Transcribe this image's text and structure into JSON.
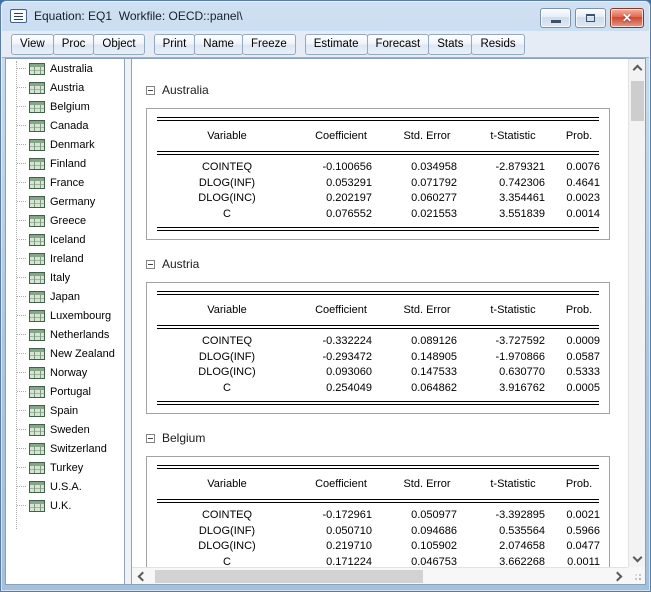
{
  "window": {
    "title": "Equation: EQ1  Workfile: OECD::panel\\"
  },
  "toolbar": {
    "groups": [
      [
        "View",
        "Proc",
        "Object"
      ],
      [
        "Print",
        "Name",
        "Freeze"
      ],
      [
        "Estimate",
        "Forecast",
        "Stats",
        "Resids"
      ]
    ]
  },
  "sidebar": {
    "items": [
      "Australia",
      "Austria",
      "Belgium",
      "Canada",
      "Denmark",
      "Finland",
      "France",
      "Germany",
      "Greece",
      "Iceland",
      "Ireland",
      "Italy",
      "Japan",
      "Luxembourg",
      "Netherlands",
      "New Zealand",
      "Norway",
      "Portugal",
      "Spain",
      "Sweden",
      "Switzerland",
      "Turkey",
      "U.S.A.",
      "U.K."
    ]
  },
  "main": {
    "columns": [
      "Variable",
      "Coefficient",
      "Std. Error",
      "t-Statistic",
      "Prob."
    ],
    "sections": [
      {
        "title": "Australia",
        "rows": [
          [
            "COINTEQ",
            "-0.100656",
            "0.034958",
            "-2.879321",
            "0.0076"
          ],
          [
            "DLOG(INF)",
            "0.053291",
            "0.071792",
            "0.742306",
            "0.4641"
          ],
          [
            "DLOG(INC)",
            "0.202197",
            "0.060277",
            "3.354461",
            "0.0023"
          ],
          [
            "C",
            "0.076552",
            "0.021553",
            "3.551839",
            "0.0014"
          ]
        ]
      },
      {
        "title": "Austria",
        "rows": [
          [
            "COINTEQ",
            "-0.332224",
            "0.089126",
            "-3.727592",
            "0.0009"
          ],
          [
            "DLOG(INF)",
            "-0.293472",
            "0.148905",
            "-1.970866",
            "0.0587"
          ],
          [
            "DLOG(INC)",
            "0.093060",
            "0.147533",
            "0.630770",
            "0.5333"
          ],
          [
            "C",
            "0.254049",
            "0.064862",
            "3.916762",
            "0.0005"
          ]
        ]
      },
      {
        "title": "Belgium",
        "rows": [
          [
            "COINTEQ",
            "-0.172961",
            "0.050977",
            "-3.392895",
            "0.0021"
          ],
          [
            "DLOG(INF)",
            "0.050710",
            "0.094686",
            "0.535564",
            "0.5966"
          ],
          [
            "DLOG(INC)",
            "0.219710",
            "0.105902",
            "2.074658",
            "0.0477"
          ],
          [
            "C",
            "0.171224",
            "0.046753",
            "3.662268",
            "0.0011"
          ]
        ]
      }
    ]
  },
  "icons": {
    "system_menu": "menu-lines-box",
    "minimize": "dash",
    "restore": "box-outline",
    "close": "x",
    "tree_item": "green-table-grid",
    "collapse_toggle": "minus-box"
  },
  "colors": {
    "titlebar": "#b9d1ea",
    "frame_border": "#5b7da3",
    "close_button": "#ce4632",
    "toolbar_bg": "#e6ecf5",
    "tree_icon_green": "#d4e6d2",
    "table_rule": "#000000",
    "scroll_thumb": "#cdcdcd"
  }
}
